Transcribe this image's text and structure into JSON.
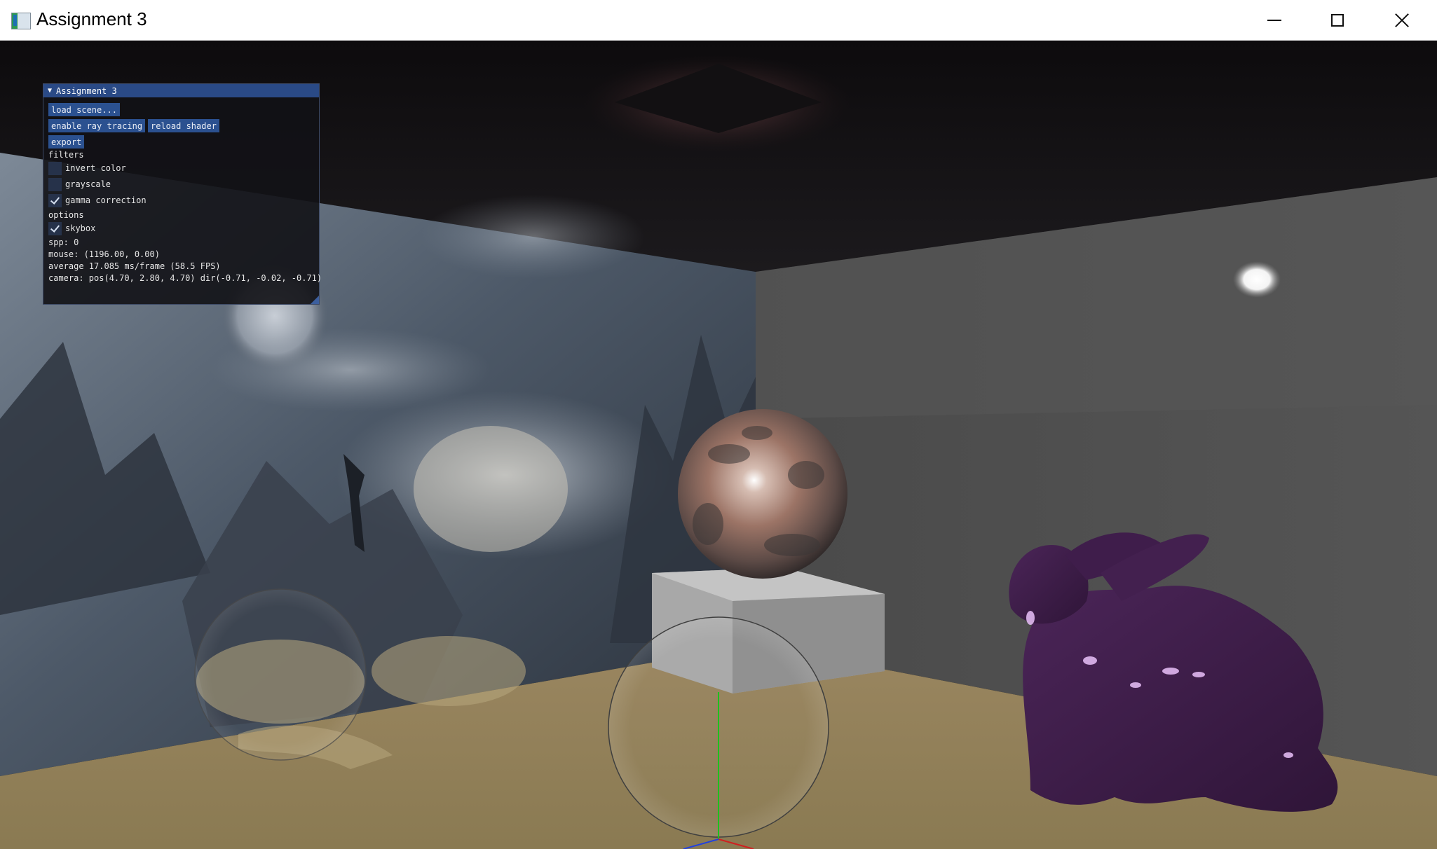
{
  "window": {
    "title": "Assignment 3",
    "icon": "app-window-icon",
    "controls": [
      "minimize-icon",
      "maximize-icon",
      "close-icon"
    ]
  },
  "panel": {
    "title": "Assignment 3",
    "buttons": {
      "load_scene": "load scene...",
      "enable_ray_tracing": "enable ray tracing",
      "reload_shader": "reload shader",
      "export": "export"
    },
    "filters_label": "filters",
    "filters": {
      "invert_color": {
        "label": "invert color",
        "checked": false
      },
      "grayscale": {
        "label": "grayscale",
        "checked": false
      },
      "gamma_correction": {
        "label": "gamma correction",
        "checked": true
      }
    },
    "options_label": "options",
    "options": {
      "skybox": {
        "label": "skybox",
        "checked": true
      }
    },
    "stats": {
      "spp": "spp: 0",
      "mouse": "mouse: (1196.00, 0.00)",
      "average": "average 17.085 ms/frame (58.5 FPS)",
      "camera": "camera: pos(4.70, 2.80, 4.70) dir(-0.71, -0.02, -0.71)"
    }
  },
  "colors": {
    "panel_header": "#2a4a86",
    "button": "#2b5190",
    "bunny": "#3b1a4a",
    "floor": "#8c7a55"
  }
}
